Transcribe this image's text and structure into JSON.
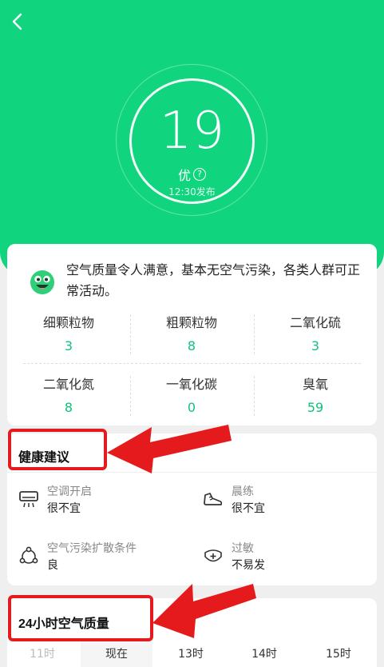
{
  "header": {
    "back_label": "<"
  },
  "aqi": {
    "value": "19",
    "level": "优",
    "help": "?",
    "published": "12:30发布"
  },
  "summary": {
    "text": "空气质量令人满意，基本无空气污染，各类人群可正常活动。",
    "pollutants": [
      {
        "name": "细颗粒物",
        "value": "3"
      },
      {
        "name": "粗颗粒物",
        "value": "8"
      },
      {
        "name": "二氧化硫",
        "value": "3"
      },
      {
        "name": "二氧化氮",
        "value": "8"
      },
      {
        "name": "一氧化碳",
        "value": "0"
      },
      {
        "name": "臭氧",
        "value": "59"
      }
    ]
  },
  "health": {
    "title": "健康建议",
    "items": [
      {
        "label": "空调开启",
        "value": "很不宜",
        "icon": "air-conditioner-icon"
      },
      {
        "label": "晨练",
        "value": "很不宜",
        "icon": "sneaker-icon"
      },
      {
        "label": "空气污染扩散条件",
        "value": "良",
        "icon": "diffusion-icon"
      },
      {
        "label": "过敏",
        "value": "不易发",
        "icon": "allergy-icon"
      }
    ]
  },
  "hourly": {
    "title": "24小时空气质量",
    "hours": [
      "11时",
      "现在",
      "13时",
      "14时",
      "15时"
    ]
  },
  "colors": {
    "brand_green": "#10d57e",
    "value_green": "#10c27a",
    "annotation_red": "#e41a1c"
  }
}
